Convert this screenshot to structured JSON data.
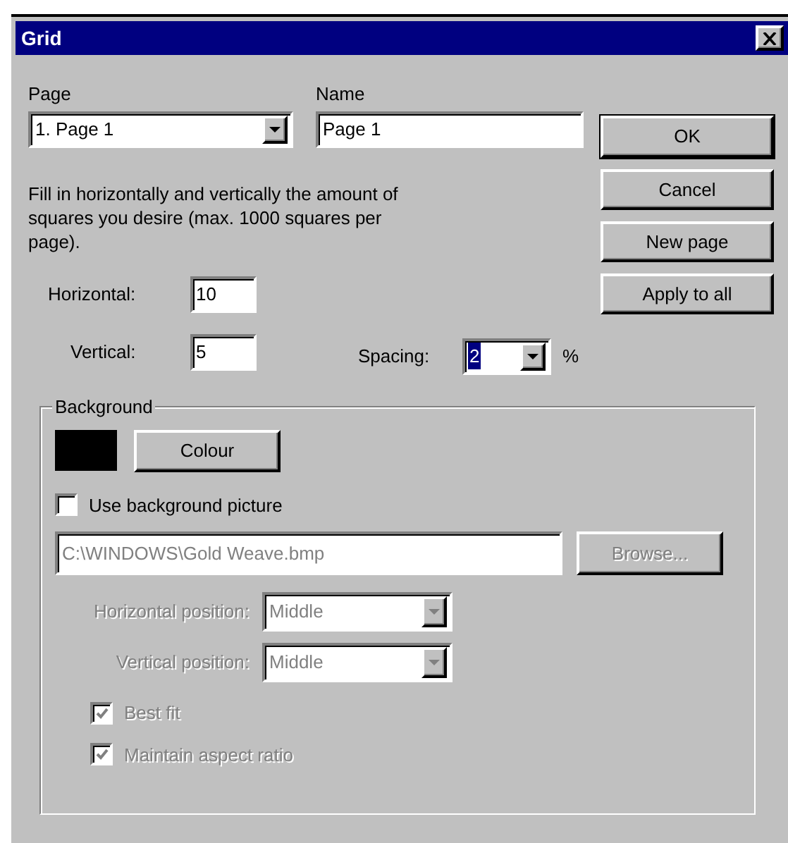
{
  "window": {
    "title": "Grid"
  },
  "page": {
    "label": "Page",
    "value": "1. Page 1"
  },
  "name": {
    "label": "Name",
    "value": "Page 1"
  },
  "buttons": [
    {
      "label": "OK",
      "default": true
    },
    {
      "label": "Cancel",
      "default": false
    },
    {
      "label": "New page",
      "default": false
    },
    {
      "label": "Apply to all",
      "default": false
    }
  ],
  "instructions": "Fill in horizontally and vertically the amount of squares you desire (max. 1000 squares per page).",
  "horizontal": {
    "label": "Horizontal:",
    "value": "10"
  },
  "vertical": {
    "label": "Vertical:",
    "value": "5"
  },
  "spacing": {
    "label": "Spacing:",
    "value": "2",
    "highlighted": true,
    "unit": "%"
  },
  "background": {
    "title": "Background",
    "colour_button": "Colour",
    "use_picture": {
      "label": "Use background picture",
      "checked": false
    },
    "path": {
      "value": "C:\\WINDOWS\\Gold Weave.bmp",
      "disabled": true
    },
    "browse": {
      "label": "Browse...",
      "disabled": true
    },
    "positions": [
      {
        "label": "Horizontal position:",
        "value": "Middle",
        "disabled": true
      },
      {
        "label": "Vertical position:",
        "value": "Middle",
        "disabled": true
      }
    ],
    "options": [
      {
        "label": "Best fit",
        "checked": true,
        "disabled": true
      },
      {
        "label": "Maintain aspect ratio",
        "checked": true,
        "disabled": true
      }
    ]
  }
}
